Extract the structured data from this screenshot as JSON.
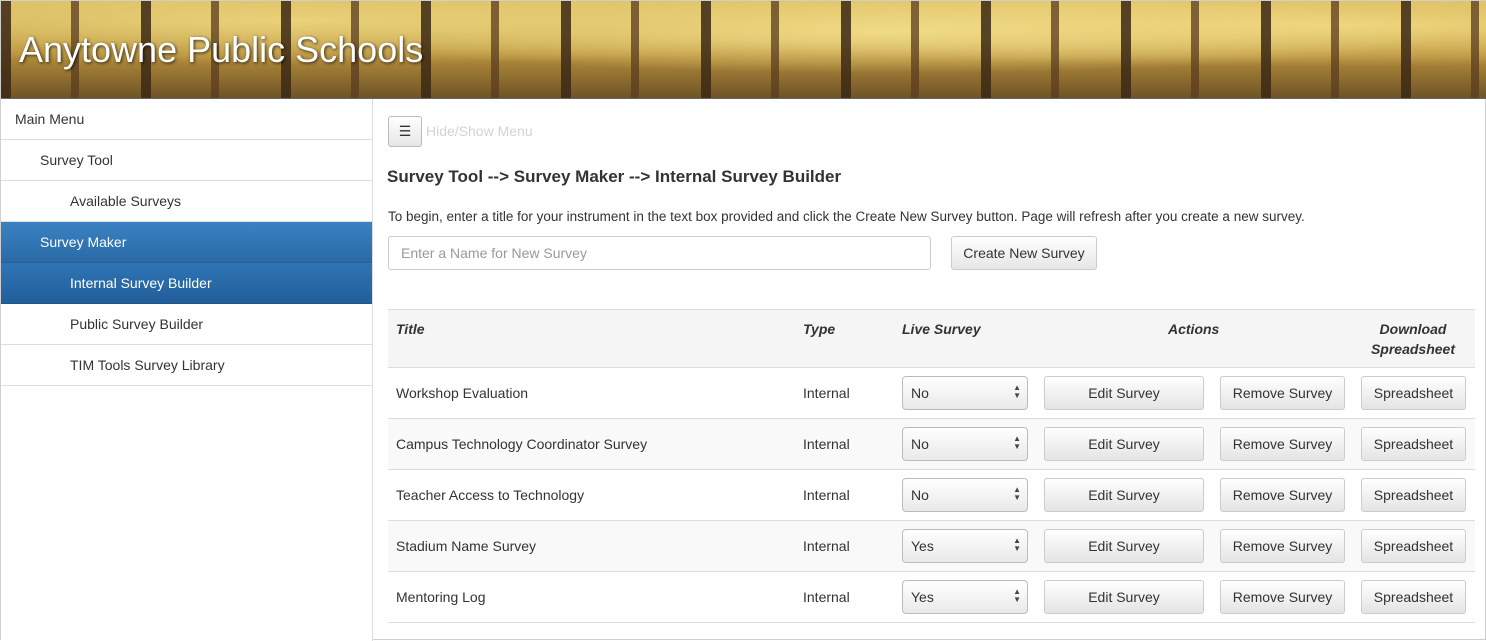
{
  "header": {
    "title": "Anytowne Public Schools"
  },
  "sidebar": {
    "items": [
      {
        "label": "Main Menu",
        "level": 0,
        "state": "normal"
      },
      {
        "label": "Survey Tool",
        "level": 1,
        "state": "normal"
      },
      {
        "label": "Available Surveys",
        "level": 2,
        "state": "normal"
      },
      {
        "label": "Survey Maker",
        "level": 1,
        "state": "active"
      },
      {
        "label": "Internal Survey Builder",
        "level": 2,
        "state": "active-child"
      },
      {
        "label": "Public Survey Builder",
        "level": 2,
        "state": "normal"
      },
      {
        "label": "TIM Tools Survey Library",
        "level": 2,
        "state": "normal"
      }
    ]
  },
  "main": {
    "toggle": {
      "icon": "hamburger-icon",
      "label": "Hide/Show Menu"
    },
    "breadcrumb": "Survey Tool --> Survey Maker --> Internal Survey Builder",
    "instructions": "To begin, enter a title for your instrument in the text box provided and click the Create New Survey button. Page will refresh after you create a new survey.",
    "new_survey": {
      "placeholder": "Enter a Name for New Survey",
      "value": "",
      "button_label": "Create New Survey"
    },
    "table": {
      "headers": {
        "title": "Title",
        "type": "Type",
        "live": "Live Survey",
        "actions": "Actions",
        "download_line1": "Download",
        "download_line2": "Spreadsheet"
      },
      "rows": [
        {
          "title": "Workshop Evaluation",
          "type": "Internal",
          "live": "No",
          "edit": "Edit Survey",
          "remove": "Remove Survey",
          "sheet": "Spreadsheet"
        },
        {
          "title": "Campus Technology Coordinator Survey",
          "type": "Internal",
          "live": "No",
          "edit": "Edit Survey",
          "remove": "Remove Survey",
          "sheet": "Spreadsheet"
        },
        {
          "title": "Teacher Access to Technology",
          "type": "Internal",
          "live": "No",
          "edit": "Edit Survey",
          "remove": "Remove Survey",
          "sheet": "Spreadsheet"
        },
        {
          "title": "Stadium Name Survey",
          "type": "Internal",
          "live": "Yes",
          "edit": "Edit Survey",
          "remove": "Remove Survey",
          "sheet": "Spreadsheet"
        },
        {
          "title": "Mentoring Log",
          "type": "Internal",
          "live": "Yes",
          "edit": "Edit Survey",
          "remove": "Remove Survey",
          "sheet": "Spreadsheet"
        }
      ]
    }
  },
  "colors": {
    "nav_active": "#2f75b6",
    "banner_gold": "#d9b85a"
  }
}
